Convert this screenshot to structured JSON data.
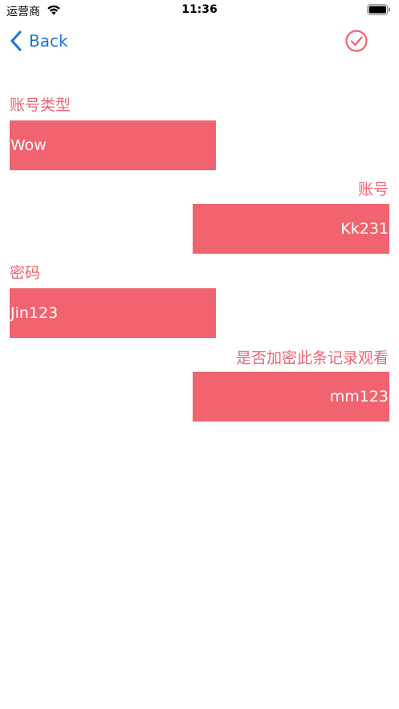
{
  "status_bar": {
    "carrier": "运营商",
    "time": "11:36",
    "wifi_icon": "wifi-icon",
    "battery_icon": "battery-icon"
  },
  "nav": {
    "back_label": "Back",
    "back_icon": "chevron-left-icon",
    "confirm_icon": "checkmark-circle-icon",
    "accent_color": "#1a73d8",
    "confirm_color": "#ef6372"
  },
  "form": {
    "account_type": {
      "label": "账号类型",
      "value": "Wow"
    },
    "account": {
      "label": "账号",
      "value": "Kk231"
    },
    "password": {
      "label": "密码",
      "value": "Jin123"
    },
    "view_password": {
      "label": "是否加密此条记录观看",
      "value": "mm123"
    },
    "label_color": "#ef6372",
    "field_color": "#f0636f",
    "field_text_color": "#ffffff"
  }
}
